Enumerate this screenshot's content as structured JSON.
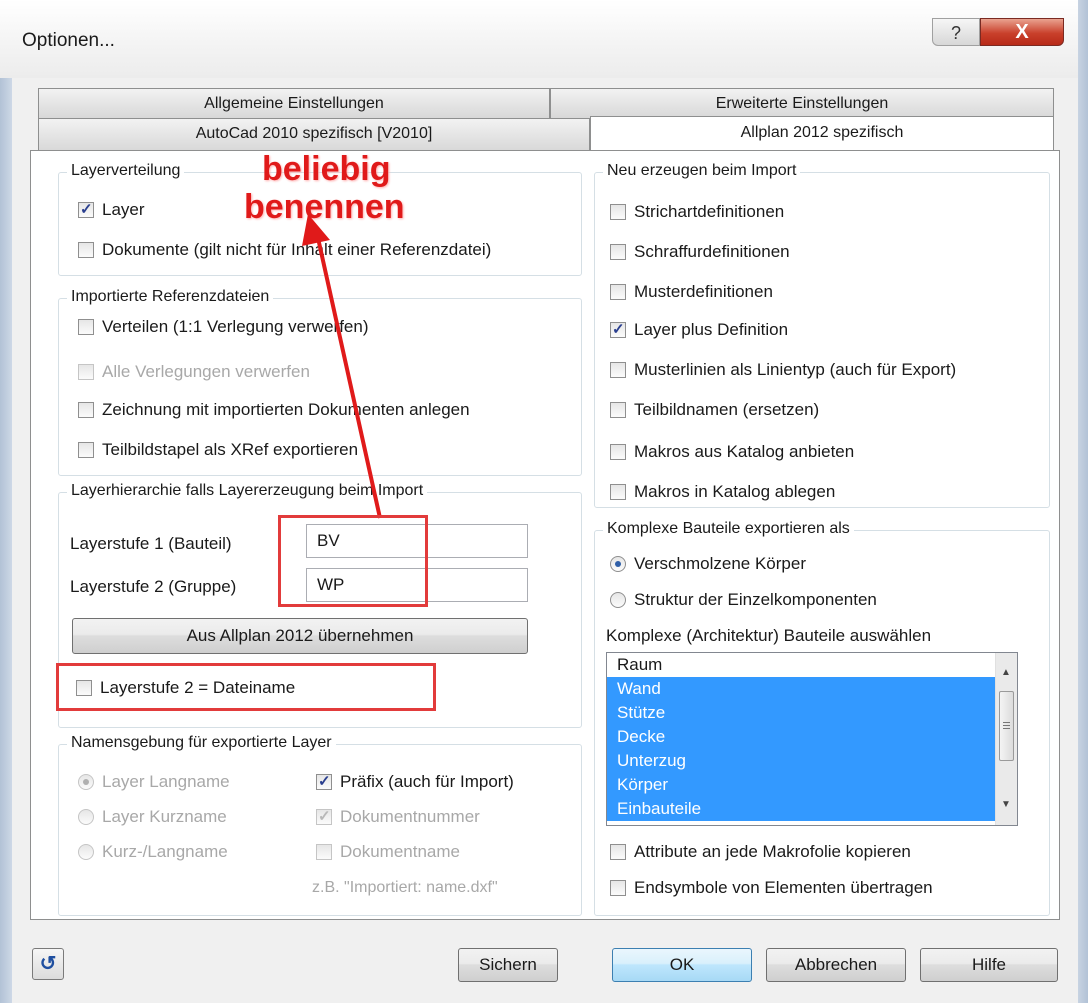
{
  "window": {
    "title": "Optionen...",
    "help_label": "?",
    "close_label": "X"
  },
  "tabs": {
    "row1": [
      "Allgemeine Einstellungen",
      "Erweiterte Einstellungen"
    ],
    "row2": [
      "AutoCad 2010 spezifisch [V2010]",
      "Allplan 2012 spezifisch"
    ]
  },
  "layerverteilung": {
    "title": "Layerverteilung",
    "items": [
      {
        "label": "Layer",
        "checked": true
      },
      {
        "label": "Dokumente (gilt nicht für Inhalt einer Referenzdatei)",
        "checked": false
      }
    ]
  },
  "referenzdateien": {
    "title": "Importierte Referenzdateien",
    "items": [
      {
        "label": "Verteilen (1:1 Verlegung verwerfen)",
        "checked": false,
        "disabled": false
      },
      {
        "label": "Alle Verlegungen verwerfen",
        "checked": false,
        "disabled": true
      },
      {
        "label": "Zeichnung mit importierten Dokumenten anlegen",
        "checked": false,
        "disabled": false
      },
      {
        "label": "Teilbildstapel als XRef exportieren",
        "checked": false,
        "disabled": false
      }
    ]
  },
  "layerhierarchie": {
    "title": "Layerhierarchie falls Layererzeugung beim Import",
    "level1_label": "Layerstufe 1 (Bauteil)",
    "level1_value": "BV",
    "level2_label": "Layerstufe 2 (Gruppe)",
    "level2_value": "WP",
    "apply_button": "Aus Allplan 2012 übernehmen",
    "dateiname_label": "Layerstufe 2 = Dateiname",
    "dateiname_checked": false
  },
  "namensgebung": {
    "title": "Namensgebung für exportierte Layer",
    "radios": [
      {
        "label": "Layer Langname",
        "checked": true
      },
      {
        "label": "Layer Kurzname",
        "checked": false
      },
      {
        "label": "Kurz-/Langname",
        "checked": false
      }
    ],
    "checks": [
      {
        "label": "Präfix (auch für Import)",
        "checked": true,
        "disabled": false
      },
      {
        "label": "Dokumentnummer",
        "checked": true,
        "disabled": true
      },
      {
        "label": "Dokumentname",
        "checked": false,
        "disabled": true
      }
    ],
    "example": "z.B. \"Importiert: name.dxf\""
  },
  "neu_erzeugen": {
    "title": "Neu erzeugen beim Import",
    "items": [
      {
        "label": "Strichartdefinitionen",
        "checked": false
      },
      {
        "label": "Schraffurdefinitionen",
        "checked": false
      },
      {
        "label": "Musterdefinitionen",
        "checked": false
      },
      {
        "label": "Layer plus Definition",
        "checked": true
      },
      {
        "label": "Musterlinien als Linientyp (auch für Export)",
        "checked": false
      },
      {
        "label": "Teilbildnamen (ersetzen)",
        "checked": false
      },
      {
        "label": "Makros aus Katalog anbieten",
        "checked": false
      },
      {
        "label": "Makros in Katalog ablegen",
        "checked": false
      }
    ]
  },
  "komplexe": {
    "title": "Komplexe Bauteile exportieren als",
    "radios": [
      {
        "label": "Verschmolzene Körper",
        "checked": true
      },
      {
        "label": "Struktur der Einzelkomponenten",
        "checked": false
      }
    ],
    "list_label": "Komplexe (Architektur) Bauteile auswählen",
    "list_items": [
      {
        "label": "Raum",
        "selected": false
      },
      {
        "label": "Wand",
        "selected": true
      },
      {
        "label": "Stütze",
        "selected": true
      },
      {
        "label": "Decke",
        "selected": true
      },
      {
        "label": "Unterzug",
        "selected": true
      },
      {
        "label": "Körper",
        "selected": true
      },
      {
        "label": "Einbauteile",
        "selected": true
      }
    ],
    "after_items": [
      {
        "label": "Attribute an jede Makrofolie kopieren",
        "checked": false
      },
      {
        "label": "Endsymbole von Elementen übertragen",
        "checked": false
      }
    ]
  },
  "buttons": {
    "save": "Sichern",
    "ok": "OK",
    "cancel": "Abbrechen",
    "help": "Hilfe"
  },
  "annotation": {
    "line1": "beliebig",
    "line2": "benennen",
    "color": "#e01a1a"
  }
}
